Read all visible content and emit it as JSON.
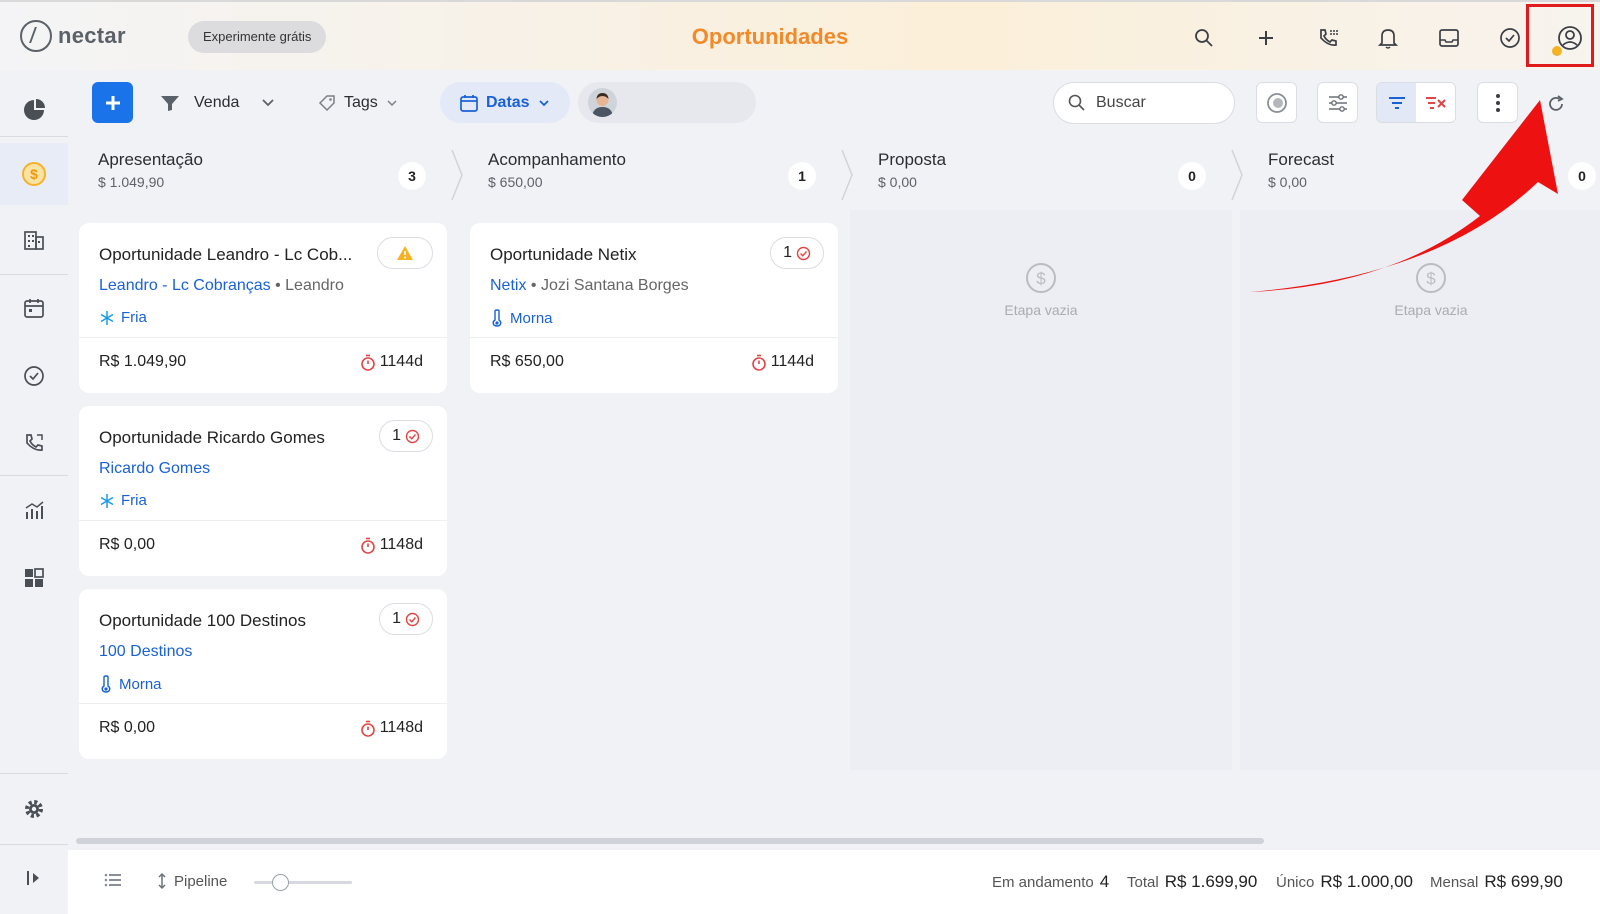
{
  "header": {
    "logo_text": "nectar",
    "trial_button": "Experimente grátis",
    "title": "Oportunidades",
    "icons": [
      "search-icon",
      "plus-icon",
      "phone-dialpad-icon",
      "bell-icon",
      "inbox-icon",
      "check-circle-icon",
      "user-account-icon"
    ]
  },
  "sidebar": {
    "items": [
      "dashboard-icon",
      "opportunities-icon",
      "companies-icon",
      "calendar-icon",
      "tasks-icon",
      "calls-icon",
      "reports-icon",
      "apps-icon",
      "settings-icon",
      "expand-icon"
    ]
  },
  "toolbar": {
    "pipeline": "Venda",
    "tags": "Tags",
    "dates": "Datas",
    "search_placeholder": "Buscar"
  },
  "stages": [
    {
      "name": "Apresentação",
      "total": "$ 1.049,90",
      "count": "3"
    },
    {
      "name": "Acompanhamento",
      "total": "$ 650,00",
      "count": "1"
    },
    {
      "name": "Proposta",
      "total": "$ 0,00",
      "count": "0"
    },
    {
      "name": "Forecast",
      "total": "$ 0,00",
      "count": "0"
    }
  ],
  "empty_label": "Etapa vazia",
  "cards": [
    {
      "title": "Oportunidade Leandro - Lc Cob...",
      "company": "Leandro - Lc Cobranças",
      "contact": "Leandro",
      "temperature": "Fria",
      "value": "R$ 1.049,90",
      "age": "1144d",
      "badge": ""
    },
    {
      "title": "Oportunidade Ricardo Gomes",
      "company": "Ricardo Gomes",
      "contact": "",
      "temperature": "Fria",
      "value": "R$ 0,00",
      "age": "1148d",
      "badge": "1"
    },
    {
      "title": "Oportunidade 100 Destinos",
      "company": "100 Destinos",
      "contact": "",
      "temperature": "Morna",
      "value": "R$ 0,00",
      "age": "1148d",
      "badge": "1"
    },
    {
      "title": "Oportunidade Netix",
      "company": "Netix",
      "contact": "Jozi Santana Borges",
      "temperature": "Morna",
      "value": "R$ 650,00",
      "age": "1144d",
      "badge": "1"
    }
  ],
  "footer": {
    "view_label": "Pipeline",
    "in_progress_label": "Em andamento",
    "in_progress_value": "4",
    "total_label": "Total",
    "total_value": "R$ 1.699,90",
    "unique_label": "Único",
    "unique_value": "R$ 1.000,00",
    "monthly_label": "Mensal",
    "monthly_value": "R$ 699,90"
  },
  "colors": {
    "accent": "#1a73e8",
    "title": "#f28a2a",
    "highlight": "#e01b1b"
  }
}
